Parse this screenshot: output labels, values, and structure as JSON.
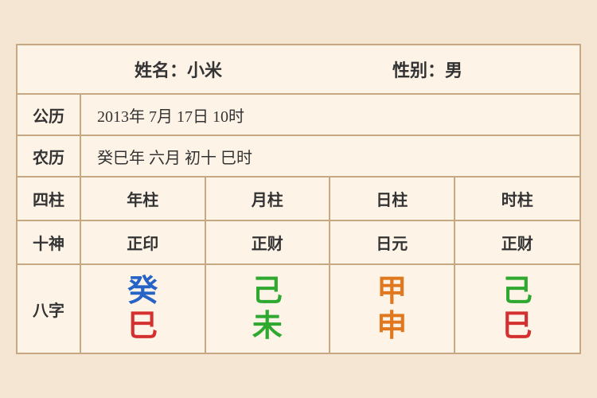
{
  "header": {
    "name_label": "姓名：小米",
    "gender_label": "性别：男"
  },
  "gregorian": {
    "label": "公历",
    "value": "2013年 7月 17日 10时"
  },
  "lunar": {
    "label": "农历",
    "value": "癸巳年 六月 初十 巳时"
  },
  "table": {
    "row_sizhu": {
      "label": "四柱",
      "cols": [
        "年柱",
        "月柱",
        "日柱",
        "时柱"
      ]
    },
    "row_shishen": {
      "label": "十神",
      "cols": [
        "正印",
        "正财",
        "日元",
        "正财"
      ]
    },
    "row_bazi": {
      "label": "八字",
      "cols": [
        {
          "top": "癸",
          "bottom": "巳",
          "top_color": "blue",
          "bottom_color": "red"
        },
        {
          "top": "己",
          "bottom": "未",
          "top_color": "green",
          "bottom_color": "green"
        },
        {
          "top": "甲",
          "bottom": "申",
          "top_color": "orange",
          "bottom_color": "orange"
        },
        {
          "top": "己",
          "bottom": "巳",
          "top_color": "green",
          "bottom_color": "red"
        }
      ]
    }
  }
}
